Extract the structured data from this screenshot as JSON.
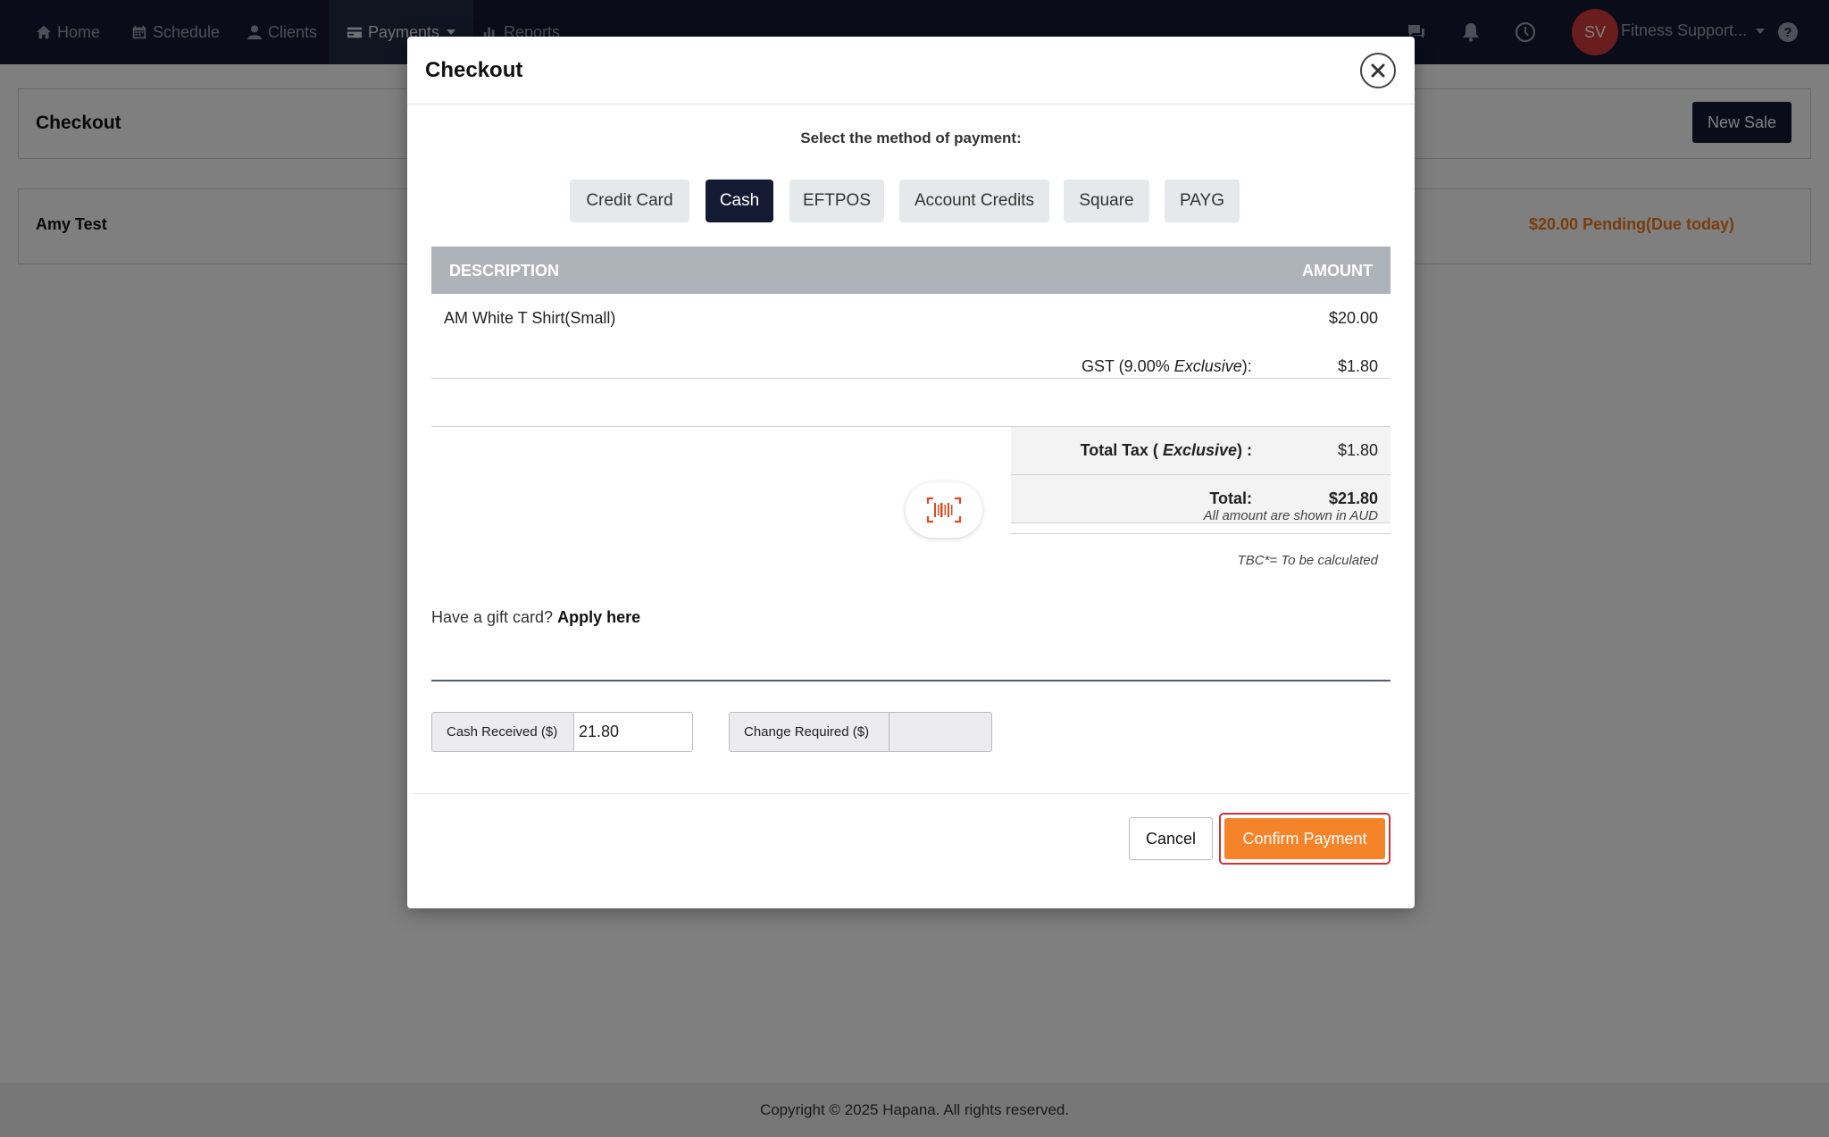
{
  "nav": {
    "items": [
      {
        "label": "Home",
        "icon": "home-icon"
      },
      {
        "label": "Schedule",
        "icon": "calendar-icon"
      },
      {
        "label": "Clients",
        "icon": "user-icon"
      },
      {
        "label": "Payments",
        "icon": "credit-card-icon",
        "active": true
      },
      {
        "label": "Reports",
        "icon": "bar-chart-icon"
      }
    ],
    "right_icons": [
      "chat-icon",
      "bell-icon",
      "clock-icon",
      "help-icon"
    ],
    "avatar_initials": "SV",
    "account_name": "Fitness Support..."
  },
  "page": {
    "title": "Checkout",
    "new_sale_label": "New Sale",
    "client_name": "Amy Test",
    "pending_status": "$20.00 Pending(Due today)"
  },
  "footer": {
    "copyright": "Copyright © 2025 Hapana. All rights reserved."
  },
  "modal": {
    "title": "Checkout",
    "payment_heading": "Select the method of payment:",
    "payment_methods": [
      "Credit Card",
      "Cash",
      "EFTPOS",
      "Account Credits",
      "Square",
      "PAYG"
    ],
    "selected_method": "Cash",
    "table": {
      "col_description": "DESCRIPTION",
      "col_amount": "AMOUNT",
      "rows": [
        {
          "description": "AM White T Shirt(Small)",
          "amount": "$20.00"
        }
      ]
    },
    "gst": {
      "label_prefix": "GST (9.00% ",
      "label_italic": "Exclusive",
      "label_suffix": "):",
      "value": "$1.80"
    },
    "total_tax": {
      "label_prefix": "Total Tax ( ",
      "label_italic": "Exclusive",
      "label_suffix": ") :",
      "value": "$1.80"
    },
    "total": {
      "label": "Total:",
      "value": "$21.80"
    },
    "aud_note": "All amount are shown in AUD",
    "tbc_note": "TBC*= To be calculated",
    "gift_card": {
      "prompt": "Have a gift card?",
      "link": "Apply here"
    },
    "cash_received": {
      "label": "Cash Received ($)",
      "value": "21.80"
    },
    "change_required": {
      "label": "Change Required ($)",
      "value": ""
    },
    "cancel_label": "Cancel",
    "confirm_label": "Confirm Payment"
  },
  "colors": {
    "nav_bg": "#151a33",
    "accent_orange": "#f5832a",
    "pending_orange": "#f07a1a",
    "avatar_red": "#d43b3b",
    "confirm_outline": "#d0323b"
  }
}
